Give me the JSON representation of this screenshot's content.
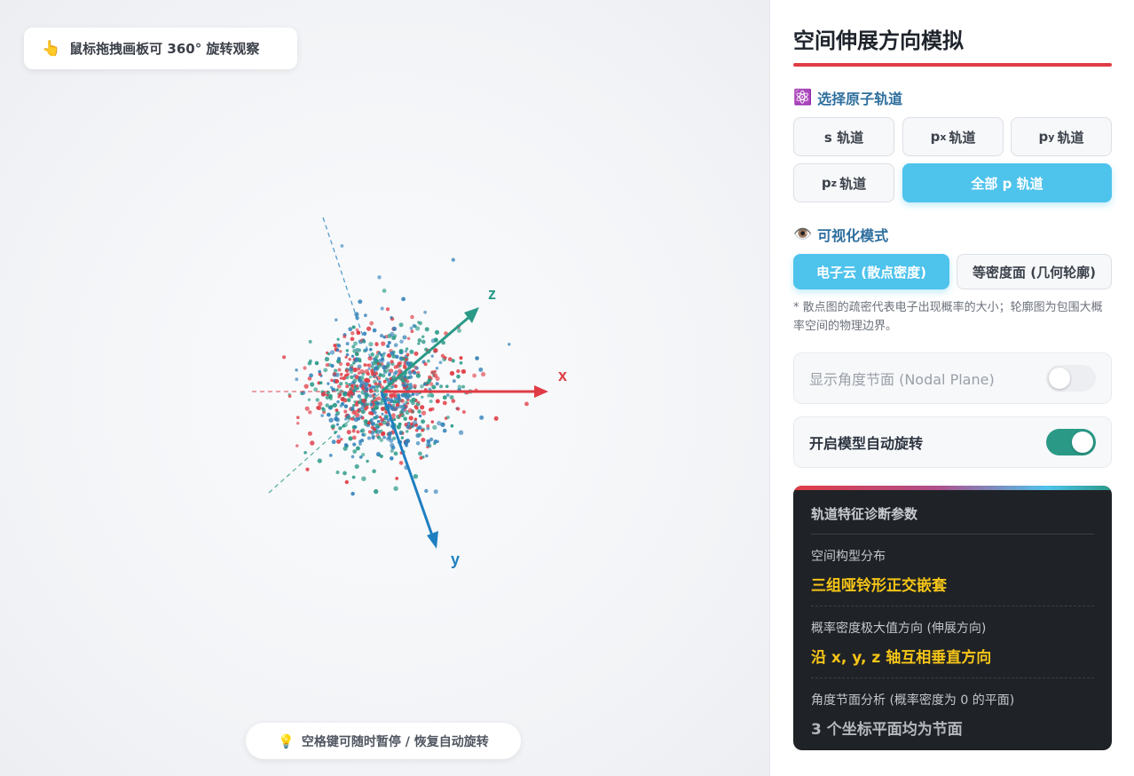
{
  "canvas": {
    "drag_hint_icon": "pointing-hand-icon",
    "drag_hint": "鼠标拖拽画板可 360° 旋转观察",
    "space_hint_icon": "lightbulb-icon",
    "space_hint": "空格键可随时暂停 / 恢复自动旋转",
    "axes": [
      {
        "label": "x",
        "color": "#e03c45"
      },
      {
        "label": "y",
        "color": "#1f7fc0"
      },
      {
        "label": "z",
        "color": "#2a9a87"
      }
    ],
    "cloud_colors": [
      "#e03c45",
      "#2f7fb8",
      "#2a9a87"
    ]
  },
  "panel": {
    "title": "空间伸展方向模拟",
    "accent_color": "#e03c45",
    "orbital_section": {
      "icon": "atom-icon",
      "heading": "选择原子轨道",
      "buttons": [
        {
          "main": "s 轨道",
          "pre": "",
          "sub": "",
          "post": "",
          "active": false
        },
        {
          "main": "",
          "pre": "p",
          "sub": "x",
          "post": "轨道",
          "active": false
        },
        {
          "main": "",
          "pre": "p",
          "sub": "y",
          "post": "轨道",
          "active": false
        },
        {
          "main": "",
          "pre": "p",
          "sub": "z",
          "post": "轨道",
          "active": false
        },
        {
          "main": "全部 p 轨道",
          "pre": "",
          "sub": "",
          "post": "",
          "active": true
        }
      ]
    },
    "viz_section": {
      "icon": "eye-icon",
      "heading": "可视化模式",
      "buttons": [
        {
          "label": "电子云 (散点密度)",
          "active": true
        },
        {
          "label": "等密度面 (几何轮廓)",
          "active": false
        }
      ],
      "note": "* 散点图的疏密代表电子出现概率的大小；轮廓图为包围大概率空间的物理边界。"
    },
    "toggles": [
      {
        "label": "显示角度节面 (Nodal Plane)",
        "on": false,
        "disabled": true
      },
      {
        "label": "开启模型自动旋转",
        "on": true,
        "disabled": false
      }
    ],
    "diagnostics": {
      "title": "轨道特征诊断参数",
      "items": [
        {
          "label": "空间构型分布",
          "value": "三组哑铃形正交嵌套",
          "style": "gold"
        },
        {
          "label": "概率密度极大值方向 (伸展方向)",
          "value": "沿 x, y, z 轴互相垂直方向",
          "style": "gold"
        },
        {
          "label": "角度节面分析 (概率密度为 0 的平面)",
          "value": "3 个坐标平面均为节面",
          "style": "grey"
        }
      ]
    }
  }
}
